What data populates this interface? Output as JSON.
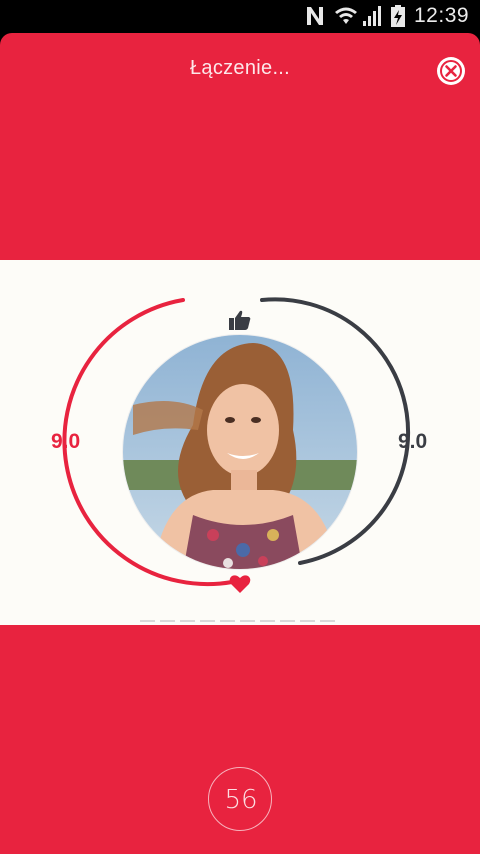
{
  "status_bar": {
    "time": "12:39",
    "icons": [
      "nfc-icon",
      "wifi-icon",
      "signal-icon",
      "battery-icon"
    ]
  },
  "header": {
    "title": "Łączenie...",
    "close_icon": "close-icon"
  },
  "match": {
    "left_score": "9.0",
    "right_score": "9.0",
    "top_icon": "thumbs-up-icon",
    "bottom_icon": "heart-icon",
    "dash_count": 10
  },
  "countdown": {
    "value": "56"
  },
  "colors": {
    "accent": "#e8233f",
    "dark": "#3a3d44",
    "band": "#fdfcf8"
  }
}
